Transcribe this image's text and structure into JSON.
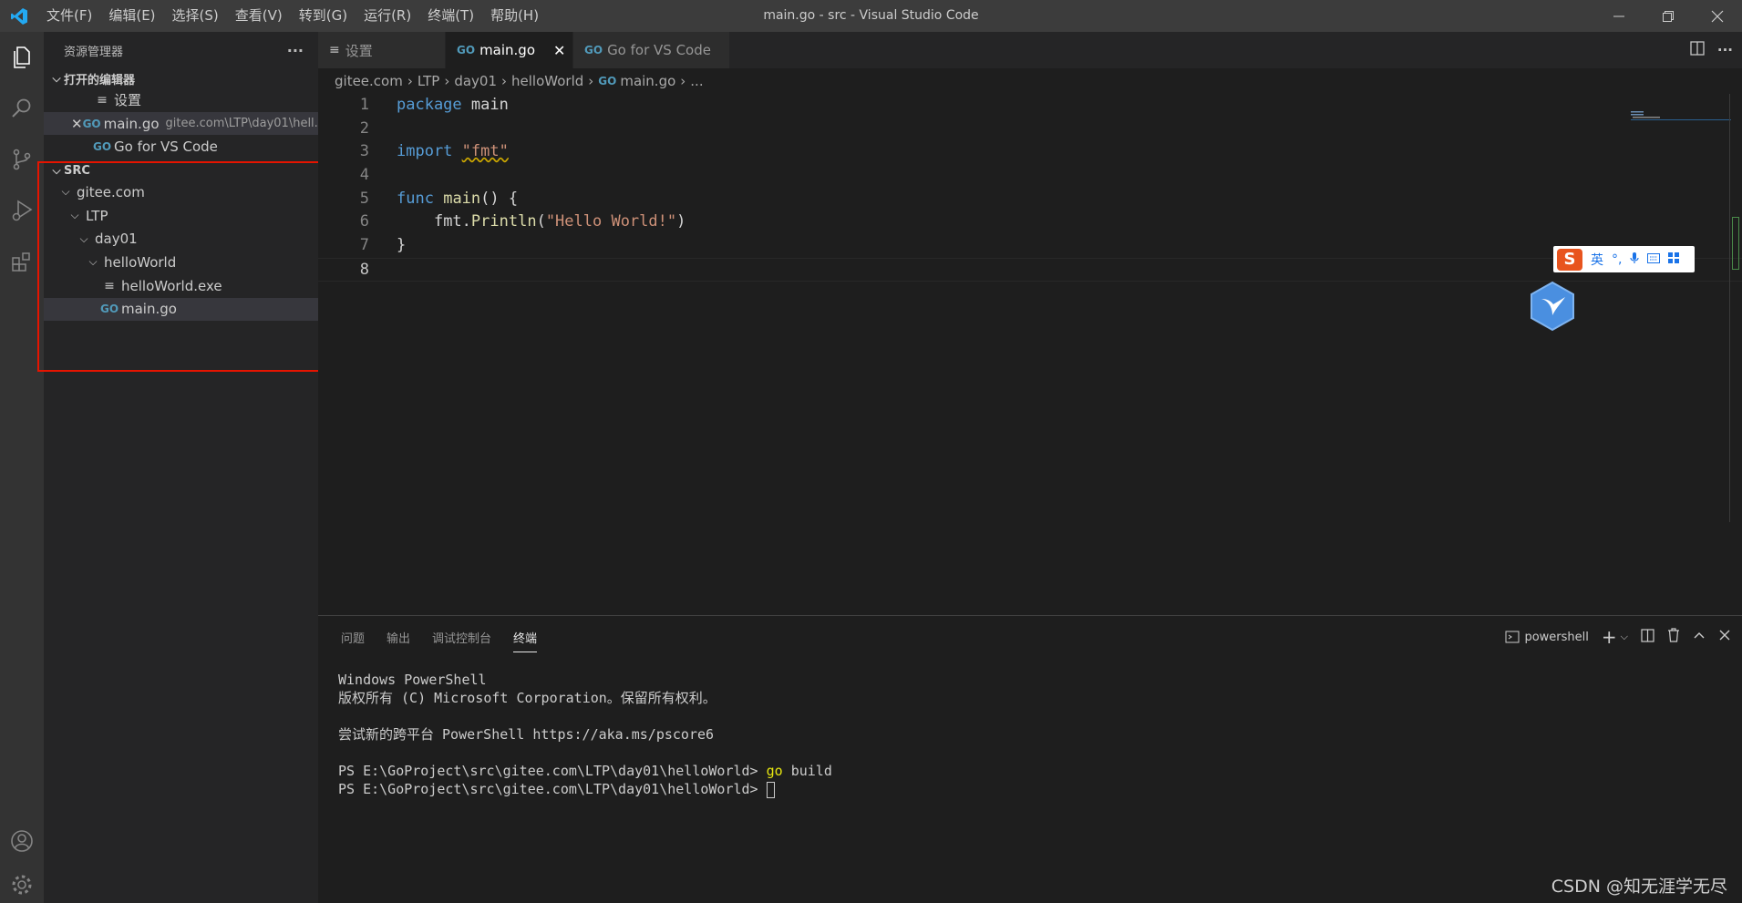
{
  "window": {
    "title": "main.go - src - Visual Studio Code",
    "menu": [
      "文件(F)",
      "编辑(E)",
      "选择(S)",
      "查看(V)",
      "转到(G)",
      "运行(R)",
      "终端(T)",
      "帮助(H)"
    ]
  },
  "sidebar": {
    "title": "资源管理器",
    "more": "···",
    "open_editors": {
      "title": "打开的编辑器",
      "items": [
        {
          "label": "设置",
          "desc": ""
        },
        {
          "label": "main.go",
          "desc": "gitee.com\\LTP\\day01\\hell..."
        },
        {
          "label": "Go for VS Code",
          "desc": ""
        }
      ]
    },
    "folder": {
      "title": "SRC",
      "tree": [
        "gitee.com",
        "LTP",
        "day01",
        "helloWorld",
        "helloWorld.exe",
        "main.go"
      ]
    }
  },
  "tabs": [
    "设置",
    "main.go",
    "Go for VS Code"
  ],
  "breadcrumb": [
    "gitee.com",
    "LTP",
    "day01",
    "helloWorld",
    "main.go",
    "..."
  ],
  "code": {
    "line_numbers": [
      "1",
      "2",
      "3",
      "4",
      "5",
      "6",
      "7",
      "8"
    ],
    "l1_kw": "package",
    "l1_id": " main",
    "l3_kw": "import",
    "l3_str": "\"fmt\"",
    "l5_kw": "func",
    "l5_fn": "main",
    "l5_rest": "() {",
    "l6_indent": "    ",
    "l6_pkg": "fmt.",
    "l6_fn": "Println",
    "l6_open": "(",
    "l6_str": "\"Hello World!\"",
    "l6_close": ")",
    "l7": "}"
  },
  "panel": {
    "tabs": [
      "问题",
      "输出",
      "调试控制台",
      "终端"
    ],
    "active_tab": "终端",
    "shell": "powershell",
    "terminal": [
      "Windows PowerShell",
      "版权所有 (C) Microsoft Corporation。保留所有权利。",
      "",
      "尝试新的跨平台 PowerShell https://aka.ms/pscore6",
      ""
    ],
    "prompt1": "PS E:\\GoProject\\src\\gitee.com\\LTP\\day01\\helloWorld> ",
    "cmd_go": "go",
    "cmd_rest": " build",
    "prompt2": "PS E:\\GoProject\\src\\gitee.com\\LTP\\day01\\helloWorld> "
  },
  "ime": {
    "logo": "S",
    "lang": "英",
    "punct": "°,"
  },
  "watermark": "CSDN @知无涯学无尽",
  "colors": {
    "accent": "#007acc",
    "highlight_box": "#e51400"
  }
}
